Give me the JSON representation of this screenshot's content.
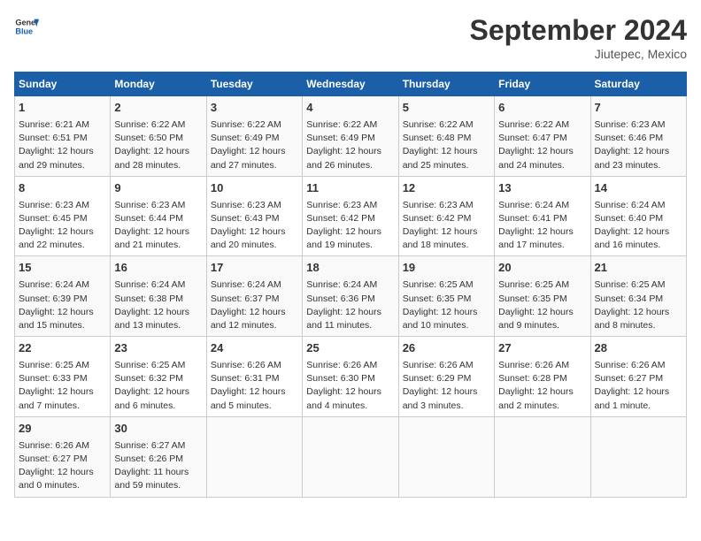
{
  "header": {
    "logo_line1": "General",
    "logo_line2": "Blue",
    "month": "September 2024",
    "location": "Jiutepec, Mexico"
  },
  "days_of_week": [
    "Sunday",
    "Monday",
    "Tuesday",
    "Wednesday",
    "Thursday",
    "Friday",
    "Saturday"
  ],
  "weeks": [
    [
      {
        "day": "1",
        "info": "Sunrise: 6:21 AM\nSunset: 6:51 PM\nDaylight: 12 hours\nand 29 minutes."
      },
      {
        "day": "2",
        "info": "Sunrise: 6:22 AM\nSunset: 6:50 PM\nDaylight: 12 hours\nand 28 minutes."
      },
      {
        "day": "3",
        "info": "Sunrise: 6:22 AM\nSunset: 6:49 PM\nDaylight: 12 hours\nand 27 minutes."
      },
      {
        "day": "4",
        "info": "Sunrise: 6:22 AM\nSunset: 6:49 PM\nDaylight: 12 hours\nand 26 minutes."
      },
      {
        "day": "5",
        "info": "Sunrise: 6:22 AM\nSunset: 6:48 PM\nDaylight: 12 hours\nand 25 minutes."
      },
      {
        "day": "6",
        "info": "Sunrise: 6:22 AM\nSunset: 6:47 PM\nDaylight: 12 hours\nand 24 minutes."
      },
      {
        "day": "7",
        "info": "Sunrise: 6:23 AM\nSunset: 6:46 PM\nDaylight: 12 hours\nand 23 minutes."
      }
    ],
    [
      {
        "day": "8",
        "info": "Sunrise: 6:23 AM\nSunset: 6:45 PM\nDaylight: 12 hours\nand 22 minutes."
      },
      {
        "day": "9",
        "info": "Sunrise: 6:23 AM\nSunset: 6:44 PM\nDaylight: 12 hours\nand 21 minutes."
      },
      {
        "day": "10",
        "info": "Sunrise: 6:23 AM\nSunset: 6:43 PM\nDaylight: 12 hours\nand 20 minutes."
      },
      {
        "day": "11",
        "info": "Sunrise: 6:23 AM\nSunset: 6:42 PM\nDaylight: 12 hours\nand 19 minutes."
      },
      {
        "day": "12",
        "info": "Sunrise: 6:23 AM\nSunset: 6:42 PM\nDaylight: 12 hours\nand 18 minutes."
      },
      {
        "day": "13",
        "info": "Sunrise: 6:24 AM\nSunset: 6:41 PM\nDaylight: 12 hours\nand 17 minutes."
      },
      {
        "day": "14",
        "info": "Sunrise: 6:24 AM\nSunset: 6:40 PM\nDaylight: 12 hours\nand 16 minutes."
      }
    ],
    [
      {
        "day": "15",
        "info": "Sunrise: 6:24 AM\nSunset: 6:39 PM\nDaylight: 12 hours\nand 15 minutes."
      },
      {
        "day": "16",
        "info": "Sunrise: 6:24 AM\nSunset: 6:38 PM\nDaylight: 12 hours\nand 13 minutes."
      },
      {
        "day": "17",
        "info": "Sunrise: 6:24 AM\nSunset: 6:37 PM\nDaylight: 12 hours\nand 12 minutes."
      },
      {
        "day": "18",
        "info": "Sunrise: 6:24 AM\nSunset: 6:36 PM\nDaylight: 12 hours\nand 11 minutes."
      },
      {
        "day": "19",
        "info": "Sunrise: 6:25 AM\nSunset: 6:35 PM\nDaylight: 12 hours\nand 10 minutes."
      },
      {
        "day": "20",
        "info": "Sunrise: 6:25 AM\nSunset: 6:35 PM\nDaylight: 12 hours\nand 9 minutes."
      },
      {
        "day": "21",
        "info": "Sunrise: 6:25 AM\nSunset: 6:34 PM\nDaylight: 12 hours\nand 8 minutes."
      }
    ],
    [
      {
        "day": "22",
        "info": "Sunrise: 6:25 AM\nSunset: 6:33 PM\nDaylight: 12 hours\nand 7 minutes."
      },
      {
        "day": "23",
        "info": "Sunrise: 6:25 AM\nSunset: 6:32 PM\nDaylight: 12 hours\nand 6 minutes."
      },
      {
        "day": "24",
        "info": "Sunrise: 6:26 AM\nSunset: 6:31 PM\nDaylight: 12 hours\nand 5 minutes."
      },
      {
        "day": "25",
        "info": "Sunrise: 6:26 AM\nSunset: 6:30 PM\nDaylight: 12 hours\nand 4 minutes."
      },
      {
        "day": "26",
        "info": "Sunrise: 6:26 AM\nSunset: 6:29 PM\nDaylight: 12 hours\nand 3 minutes."
      },
      {
        "day": "27",
        "info": "Sunrise: 6:26 AM\nSunset: 6:28 PM\nDaylight: 12 hours\nand 2 minutes."
      },
      {
        "day": "28",
        "info": "Sunrise: 6:26 AM\nSunset: 6:27 PM\nDaylight: 12 hours\nand 1 minute."
      }
    ],
    [
      {
        "day": "29",
        "info": "Sunrise: 6:26 AM\nSunset: 6:27 PM\nDaylight: 12 hours\nand 0 minutes."
      },
      {
        "day": "30",
        "info": "Sunrise: 6:27 AM\nSunset: 6:26 PM\nDaylight: 11 hours\nand 59 minutes."
      },
      {
        "day": "",
        "info": ""
      },
      {
        "day": "",
        "info": ""
      },
      {
        "day": "",
        "info": ""
      },
      {
        "day": "",
        "info": ""
      },
      {
        "day": "",
        "info": ""
      }
    ]
  ]
}
